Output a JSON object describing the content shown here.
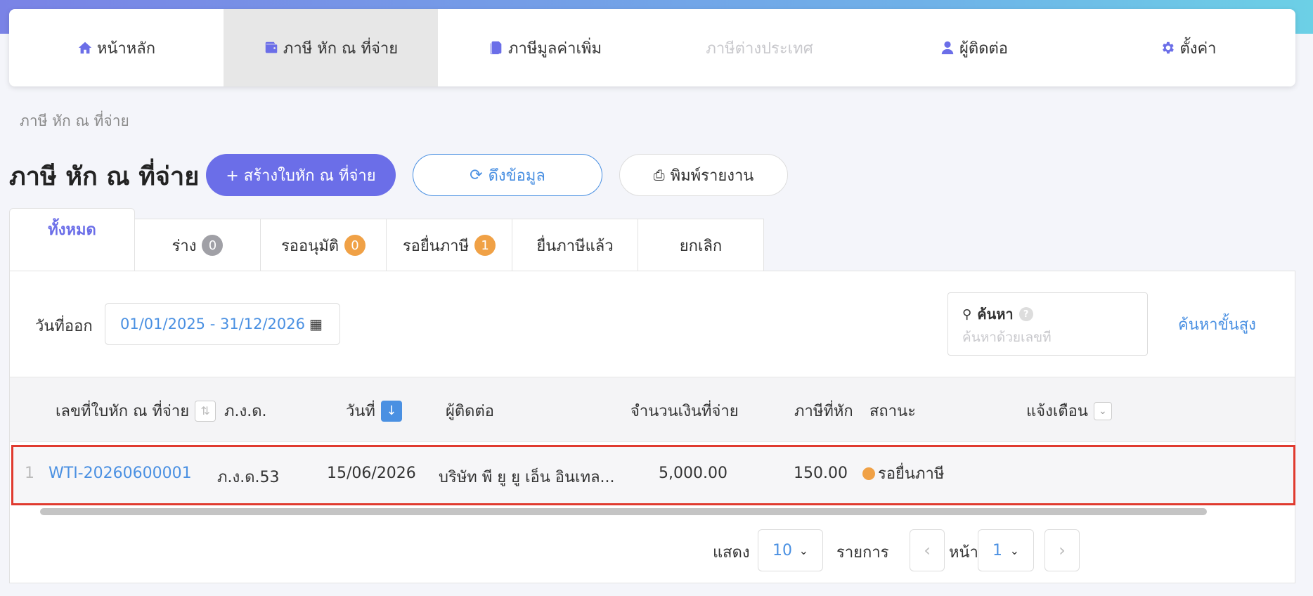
{
  "nav": {
    "items": [
      {
        "label": "หน้าหลัก",
        "icon": "home-icon",
        "active": false,
        "disabled": false
      },
      {
        "label": "ภาษี หัก ณ ที่จ่าย",
        "icon": "wallet-icon",
        "active": true,
        "disabled": false
      },
      {
        "label": "ภาษีมูลค่าเพิ่ม",
        "icon": "document-icon",
        "active": false,
        "disabled": false
      },
      {
        "label": "ภาษีต่างประเทศ",
        "icon": "",
        "active": false,
        "disabled": true
      },
      {
        "label": "ผู้ติดต่อ",
        "icon": "user-icon",
        "active": false,
        "disabled": false
      },
      {
        "label": "ตั้งค่า",
        "icon": "gear-icon",
        "active": false,
        "disabled": false
      }
    ]
  },
  "breadcrumb": "ภาษี หัก ณ ที่จ่าย",
  "page_title": "ภาษี หัก ณ ที่จ่าย",
  "actions": {
    "create": "+ สร้างใบหัก ณ ที่จ่าย",
    "fetch": "ดึงข้อมูล",
    "print": "พิมพ์รายงาน"
  },
  "tabs": [
    {
      "label": "ทั้งหมด",
      "count": null,
      "active": true
    },
    {
      "label": "ร่าง",
      "count": "0",
      "badge": "gray"
    },
    {
      "label": "รออนุมัติ",
      "count": "0",
      "badge": "orange"
    },
    {
      "label": "รอยื่นภาษี",
      "count": "1",
      "badge": "orange"
    },
    {
      "label": "ยื่นภาษีแล้ว",
      "count": null
    },
    {
      "label": "ยกเลิก",
      "count": null
    }
  ],
  "filter": {
    "date_label": "วันที่ออก",
    "date_range": "01/01/2025 - 31/12/2026"
  },
  "search": {
    "label": "ค้นหา",
    "help": "?",
    "placeholder": "ค้นหาด้วยเลขที่",
    "advanced": "ค้นหาขั้นสูง"
  },
  "table": {
    "headers": {
      "doc_no": "เลขที่ใบหัก ณ ที่จ่าย",
      "form": "ภ.ง.ด.",
      "date": "วันที่",
      "contact": "ผู้ติดต่อ",
      "amount": "จำนวนเงินที่จ่าย",
      "tax": "ภาษีที่หัก",
      "status": "สถานะ",
      "notify": "แจ้งเตือน"
    },
    "rows": [
      {
        "index": "1",
        "doc_no": "WTI-20260600001",
        "form": "ภ.ง.ด.53",
        "date": "15/06/2026",
        "contact": "บริษัท พี ยู ยู เอ็น อินเทล...",
        "amount": "5,000.00",
        "tax": "150.00",
        "status": "รอยื่นภาษี",
        "status_color": "#f0a146"
      }
    ]
  },
  "pager": {
    "show_label": "แสดง",
    "page_size": "10",
    "items_label": "รายการ",
    "page_label": "หน้า",
    "page": "1"
  },
  "colors": {
    "accent": "#6b6ee8",
    "link": "#4a90e2",
    "warning": "#f0a146",
    "highlight_border": "#e03a2f"
  }
}
